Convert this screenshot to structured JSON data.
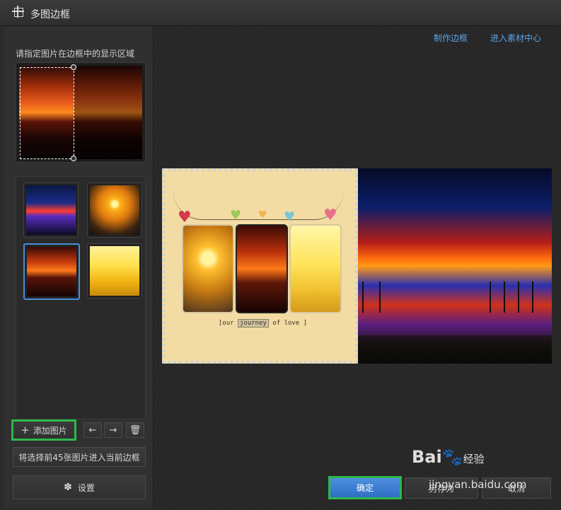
{
  "window": {
    "title": "多图边框",
    "icon": "frame-icon"
  },
  "left_panel": {
    "hint": "请指定图片在边框中的显示区域",
    "thumbnails": [
      {
        "name": "thumb-blue-sunset",
        "selected": false
      },
      {
        "name": "thumb-sun-pier",
        "selected": false
      },
      {
        "name": "thumb-red-sunset",
        "selected": true
      },
      {
        "name": "thumb-yellow-couple",
        "selected": false
      }
    ],
    "add_button": "添加图片",
    "move_left_icon": "arrow-left-icon",
    "move_right_icon": "arrow-right-icon",
    "delete_icon": "trash-icon",
    "load_button": "将选择前45张图片进入当前边框",
    "settings_button": "设置"
  },
  "top_links": {
    "make_frame": "制作边框",
    "asset_center": "进入素材中心"
  },
  "preview": {
    "caption_left": "[our",
    "caption_highlight": "journey",
    "caption_right": "of love ]"
  },
  "footer": {
    "ok": "确定",
    "save_as": "另存为",
    "cancel": "取消"
  },
  "watermark": {
    "brand": "Bai",
    "brand_suffix": "经验",
    "url": "jingyan.baidu.com"
  },
  "colors": {
    "accent_blue": "#5aa4e6",
    "highlight_green": "#2fb84a",
    "primary_button": "#3d7fd4"
  }
}
